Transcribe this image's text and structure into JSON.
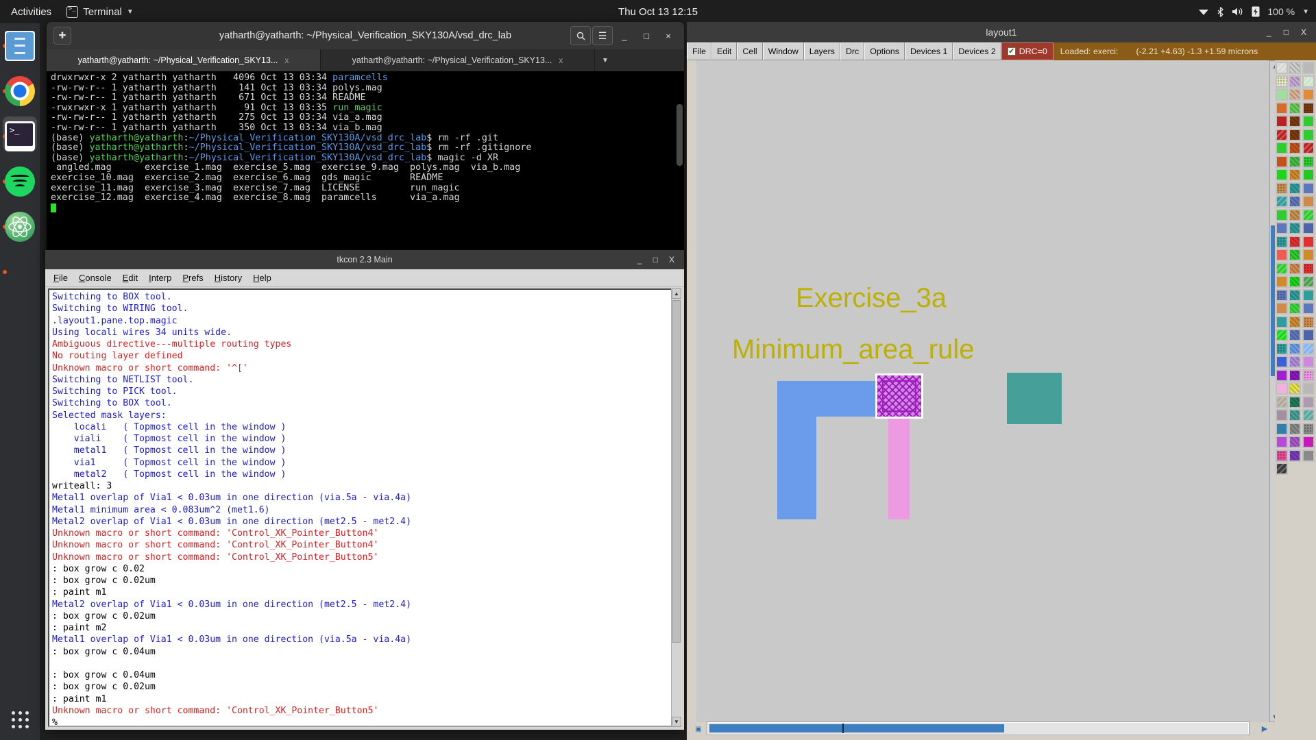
{
  "topbar": {
    "activities": "Activities",
    "app_menu": "Terminal",
    "app_icon": "terminal-icon",
    "clock": "Thu Oct 13  12:15",
    "tray": {
      "wifi_icon": "wifi-icon",
      "bluetooth_icon": "bluetooth-icon",
      "volume_icon": "volume-icon",
      "battery_icon": "battery-charging-icon",
      "battery_label": "100 %",
      "caret_icon": "chevron-down-icon"
    }
  },
  "dock": {
    "items": [
      {
        "name": "files",
        "label": "Files"
      },
      {
        "name": "chrome",
        "label": "Google Chrome"
      },
      {
        "name": "terminal",
        "label": "Terminal",
        "active": true
      },
      {
        "name": "spotify",
        "label": "Spotify"
      },
      {
        "name": "atom",
        "label": "Atom"
      }
    ],
    "show_apps": "Show Applications"
  },
  "terminal": {
    "title": "yatharth@yatharth: ~/Physical_Verification_SKY130A/vsd_drc_lab",
    "new_tab_icon": "new-tab-icon",
    "search_icon": "search-icon",
    "menu_icon": "hamburger-icon",
    "minimize": "_",
    "maximize": "□",
    "close": "×",
    "tabs": [
      {
        "label": "yatharth@yatharth: ~/Physical_Verification_SKY13...",
        "close": "x",
        "selected": true
      },
      {
        "label": "yatharth@yatharth: ~/Physical_Verification_SKY13...",
        "close": "x",
        "selected": false
      }
    ],
    "tab_list_icon": "chevron-down-icon",
    "lines": [
      {
        "parts": [
          {
            "t": "drwxrwxr-x 2 yatharth yatharth   4096 Oct 13 03:34 ",
            "c": "c-base"
          },
          {
            "t": "paramcells",
            "c": "c-dir"
          }
        ]
      },
      {
        "parts": [
          {
            "t": "-rw-rw-r-- 1 yatharth yatharth    141 Oct 13 03:34 polys.mag",
            "c": "c-base"
          }
        ]
      },
      {
        "parts": [
          {
            "t": "-rw-rw-r-- 1 yatharth yatharth    671 Oct 13 03:34 README",
            "c": "c-base"
          }
        ]
      },
      {
        "parts": [
          {
            "t": "-rwxrwxr-x 1 yatharth yatharth     91 Oct 13 03:35 ",
            "c": "c-base"
          },
          {
            "t": "run_magic",
            "c": "c-exe"
          }
        ]
      },
      {
        "parts": [
          {
            "t": "-rw-rw-r-- 1 yatharth yatharth    275 Oct 13 03:34 via_a.mag",
            "c": "c-base"
          }
        ]
      },
      {
        "parts": [
          {
            "t": "-rw-rw-r-- 1 yatharth yatharth    350 Oct 13 03:34 via_b.mag",
            "c": "c-base"
          }
        ]
      },
      {
        "parts": [
          {
            "t": "(base) ",
            "c": "c-base"
          },
          {
            "t": "yatharth@yatharth",
            "c": "c-user"
          },
          {
            "t": ":",
            "c": "c-base"
          },
          {
            "t": "~/Physical_Verification_SKY130A/vsd_drc_lab",
            "c": "c-path"
          },
          {
            "t": "$ rm -rf .git",
            "c": "c-base"
          }
        ]
      },
      {
        "parts": [
          {
            "t": "(base) ",
            "c": "c-base"
          },
          {
            "t": "yatharth@yatharth",
            "c": "c-user"
          },
          {
            "t": ":",
            "c": "c-base"
          },
          {
            "t": "~/Physical_Verification_SKY130A/vsd_drc_lab",
            "c": "c-path"
          },
          {
            "t": "$ rm -rf .gitignore",
            "c": "c-base"
          }
        ]
      },
      {
        "parts": [
          {
            "t": "(base) ",
            "c": "c-base"
          },
          {
            "t": "yatharth@yatharth",
            "c": "c-user"
          },
          {
            "t": ":",
            "c": "c-base"
          },
          {
            "t": "~/Physical_Verification_SKY130A/vsd_drc_lab",
            "c": "c-path"
          },
          {
            "t": "$ magic -d XR",
            "c": "c-base"
          }
        ]
      },
      {
        "parts": [
          {
            "t": " angled.mag      exercise_1.mag  exercise_5.mag  exercise_9.mag  polys.mag  via_b.mag",
            "c": "c-base"
          }
        ]
      },
      {
        "parts": [
          {
            "t": "exercise_10.mag  exercise_2.mag  exercise_6.mag  gds_magic       README",
            "c": "c-base"
          }
        ]
      },
      {
        "parts": [
          {
            "t": "exercise_11.mag  exercise_3.mag  exercise_7.mag  LICENSE         run_magic",
            "c": "c-base"
          }
        ]
      },
      {
        "parts": [
          {
            "t": "exercise_12.mag  exercise_4.mag  exercise_8.mag  paramcells      via_a.mag",
            "c": "c-base"
          }
        ]
      }
    ]
  },
  "tkcon": {
    "title": "tkcon 2.3 Main",
    "minimize": "_",
    "maximize": "□",
    "close": "X",
    "menus": [
      "File",
      "Console",
      "Edit",
      "Interp",
      "Prefs",
      "History",
      "Help"
    ],
    "lines": [
      {
        "t": "Switching to BOX tool.",
        "c": "blue"
      },
      {
        "t": "Switching to WIRING tool.",
        "c": "blue"
      },
      {
        "t": ".layout1.pane.top.magic",
        "c": "blue"
      },
      {
        "t": "Using locali wires 34 units wide.",
        "c": "blue"
      },
      {
        "t": "Ambiguous directive---multiple routing types",
        "c": "red"
      },
      {
        "t": "No routing layer defined",
        "c": "red"
      },
      {
        "t": "Unknown macro or short command: '^['",
        "c": "red"
      },
      {
        "t": "Switching to NETLIST tool.",
        "c": "blue"
      },
      {
        "t": "Switching to PICK tool.",
        "c": "blue"
      },
      {
        "t": "Switching to BOX tool.",
        "c": "blue"
      },
      {
        "t": "Selected mask layers:",
        "c": "blue"
      },
      {
        "t": "    locali   ( Topmost cell in the window )",
        "c": "blue"
      },
      {
        "t": "    viali    ( Topmost cell in the window )",
        "c": "blue"
      },
      {
        "t": "    metal1   ( Topmost cell in the window )",
        "c": "blue"
      },
      {
        "t": "    via1     ( Topmost cell in the window )",
        "c": "blue"
      },
      {
        "t": "    metal2   ( Topmost cell in the window )",
        "c": "blue"
      },
      {
        "t": "writeall: 3",
        "c": "blk"
      },
      {
        "t": "Metal1 overlap of Via1 < 0.03um in one direction (via.5a - via.4a)",
        "c": "blue"
      },
      {
        "t": "Metal1 minimum area < 0.083um^2 (met1.6)",
        "c": "blue"
      },
      {
        "t": "Metal2 overlap of Via1 < 0.03um in one direction (met2.5 - met2.4)",
        "c": "blue"
      },
      {
        "t": "Unknown macro or short command: 'Control_XK_Pointer_Button4'",
        "c": "red"
      },
      {
        "t": "Unknown macro or short command: 'Control_XK_Pointer_Button4'",
        "c": "red"
      },
      {
        "t": "Unknown macro or short command: 'Control_XK_Pointer_Button5'",
        "c": "red"
      },
      {
        "t": ": box grow c 0.02",
        "c": "blk"
      },
      {
        "t": ": box grow c 0.02um",
        "c": "blk"
      },
      {
        "t": ": paint m1",
        "c": "blk"
      },
      {
        "t": "Metal2 overlap of Via1 < 0.03um in one direction (met2.5 - met2.4)",
        "c": "blue"
      },
      {
        "t": ": box grow c 0.02um",
        "c": "blk"
      },
      {
        "t": ": paint m2",
        "c": "blk"
      },
      {
        "t": "Metal1 overlap of Via1 < 0.03um in one direction (via.5a - via.4a)",
        "c": "blue"
      },
      {
        "t": ": box grow c 0.04um",
        "c": "blk"
      },
      {
        "t": "",
        "c": "blk"
      },
      {
        "t": ": box grow c 0.04um",
        "c": "blk"
      },
      {
        "t": ": box grow c 0.02um",
        "c": "blk"
      },
      {
        "t": ": paint m1",
        "c": "blk"
      },
      {
        "t": "Unknown macro or short command: 'Control_XK_Pointer_Button5'",
        "c": "red"
      },
      {
        "t": "%",
        "c": "blk"
      }
    ]
  },
  "magic": {
    "title": "layout1",
    "minimize": "_",
    "maximize": "□",
    "close": "X",
    "menus": [
      "File",
      "Edit",
      "Cell",
      "Window",
      "Layers",
      "Drc",
      "Options",
      "Devices 1",
      "Devices 2"
    ],
    "drc_badge": {
      "label": "DRC=0",
      "check": "✔",
      "color": "#a0392b"
    },
    "status": {
      "loaded": "Loaded: exerci:",
      "coords": "(-2.21 +4.63) -1.3 +1.59 microns"
    },
    "canvas": {
      "labels": [
        "Exercise_3a",
        "Minimum_area_rule"
      ],
      "label_color": "#bdb000",
      "background": "#c9c9c9",
      "shapes": [
        {
          "name": "metal2-l-shape",
          "color": "#6b9ceb"
        },
        {
          "name": "metal1-vertical",
          "color": "#ee9ae2"
        },
        {
          "name": "via1-selected",
          "color": "#d884ec"
        },
        {
          "name": "locali-square",
          "color": "#46a099"
        }
      ]
    },
    "scroll": {
      "up_icon": "arrow-up-icon",
      "down_icon": "arrow-down-icon",
      "left_icon": "arrow-left-icon",
      "right_icon": "arrow-right-icon",
      "zoom_icon": "zoom-box-icon"
    },
    "palette_title": "layer-palette"
  }
}
